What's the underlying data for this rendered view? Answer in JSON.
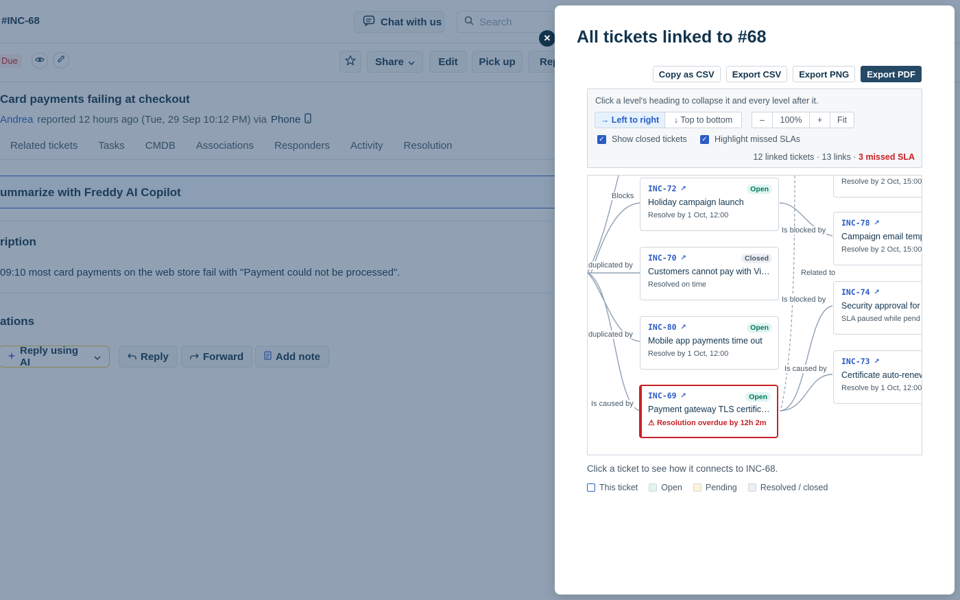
{
  "background": {
    "ticket_id": "#INC-68",
    "chat_button": "Chat with us",
    "search_placeholder": "Search",
    "due_badge": "Due",
    "share_label": "Share",
    "edit_label": "Edit",
    "pickup_label": "Pick up",
    "reply_partial": "Rep",
    "subject": "Card payments failing at checkout",
    "reporter_name": "Andrea",
    "reported_text": "reported 12 hours ago (Tue, 29 Sep 10:12 PM) via",
    "channel": "Phone",
    "tabs": [
      "Related tickets",
      "Tasks",
      "CMDB",
      "Associations",
      "Responders",
      "Activity",
      "Resolution"
    ],
    "freddy_text": "ummarize with Freddy AI Copilot",
    "description_heading": "ription",
    "description_text": "09:10 most card payments on the web store fail with \"Payment could not be processed\".",
    "conversations_heading": "ations",
    "reply_ai": "Reply using AI",
    "reply": "Reply",
    "forward": "Forward",
    "add_note": "Add note"
  },
  "modal": {
    "title": "All tickets linked to #68",
    "exports": [
      "Copy as CSV",
      "Export CSV",
      "Export PNG",
      "Export PDF"
    ],
    "hint": "Click a level's heading to collapse it and every level after it.",
    "direction": {
      "left_to_right": "→ Left to right",
      "top_to_bottom": "↓ Top to bottom"
    },
    "zoom": {
      "minus": "–",
      "value": "100%",
      "plus": "+",
      "fit": "Fit"
    },
    "show_closed": "Show closed tickets",
    "highlight_missed": "Highlight missed SLAs",
    "stats_text": "12 linked tickets · 13 links ·",
    "stats_missed": "3 missed SLA",
    "edge_labels": {
      "blocks": "Blocks",
      "duplicated_by_1": "duplicated by",
      "duplicated_by_2": "duplicated by",
      "is_caused_by_left": "Is caused by",
      "is_blocked_by_1": "Is blocked by",
      "related_to": "Related to",
      "is_blocked_by_2": "Is blocked by",
      "is_caused_by_right": "Is caused by"
    },
    "cards": [
      {
        "id": "INC-72",
        "status": "Open",
        "title": "Holiday campaign launch",
        "meta": "Resolve by 1 Oct, 12:00"
      },
      {
        "id": "INC-70",
        "status": "Closed",
        "title": "Customers cannot pay with Vi…",
        "meta": "Resolved on time"
      },
      {
        "id": "INC-80",
        "status": "Open",
        "title": "Mobile app payments time out",
        "meta": "Resolve by 1 Oct, 12:00"
      },
      {
        "id": "INC-69",
        "status": "Open",
        "title": "Payment gateway TLS certific…",
        "meta": "Resolution overdue by 12h 2m"
      }
    ],
    "right_cards": [
      {
        "id": "",
        "title": "",
        "meta": "Resolve by 2 Oct, 15:00"
      },
      {
        "id": "INC-78",
        "title": "Campaign email temp",
        "meta": "Resolve by 2 Oct, 15:00"
      },
      {
        "id": "INC-74",
        "title": "Security approval for",
        "meta": "SLA paused while pend"
      },
      {
        "id": "INC-73",
        "title": "Certificate auto-renew",
        "meta": "Resolve by 1 Oct, 12:00"
      }
    ],
    "footer": "Click a ticket to see how it connects to INC-68.",
    "legend": [
      {
        "label": "This ticket",
        "color": "#ffffff",
        "border": "#2c5cc5"
      },
      {
        "label": "Open",
        "color": "#e0f5f1",
        "border": "#cfd7df"
      },
      {
        "label": "Pending",
        "color": "#fff3d6",
        "border": "#cfd7df"
      },
      {
        "label": "Resolved / closed",
        "color": "#ebeff3",
        "border": "#cfd7df"
      }
    ]
  },
  "colors": {
    "accent": "#2c5cc5",
    "danger": "#c82124",
    "dark": "#12344d",
    "success": "#00795b"
  }
}
